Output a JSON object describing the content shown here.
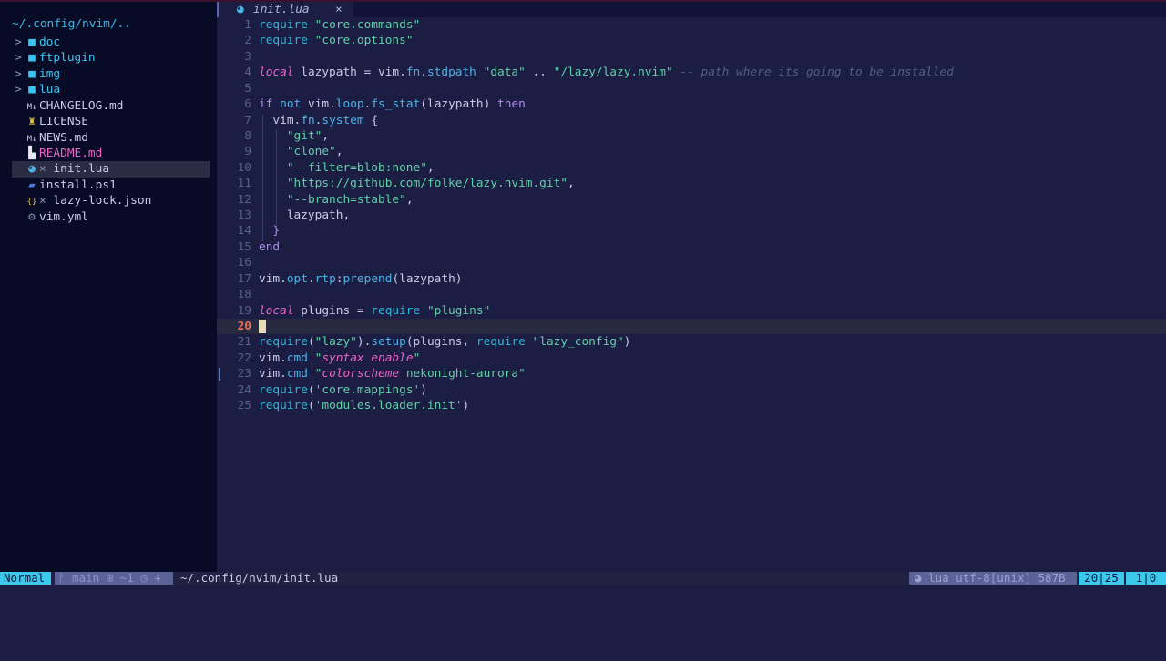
{
  "tabline": {
    "tab": {
      "icon": "lua-icon",
      "name": "init.lua",
      "close": "×"
    }
  },
  "sidebar": {
    "root": "~/.config/nvim/..",
    "items": [
      {
        "name": "doc",
        "type": "folder",
        "chevron": ">",
        "icon": "folder-icon",
        "glyph": "■"
      },
      {
        "name": "ftplugin",
        "type": "folder",
        "chevron": ">",
        "icon": "folder-icon",
        "glyph": "■"
      },
      {
        "name": "img",
        "type": "folder",
        "chevron": ">",
        "icon": "folder-icon",
        "glyph": "■"
      },
      {
        "name": "lua",
        "type": "folder",
        "chevron": ">",
        "icon": "folder-icon",
        "glyph": "■"
      },
      {
        "name": "CHANGELOG.md",
        "type": "file",
        "icon": "markdown-icon",
        "glyph": "M↓",
        "color": "#c8cbe8"
      },
      {
        "name": "LICENSE",
        "type": "file",
        "icon": "license-icon",
        "glyph": "♜",
        "color": "#e0c040"
      },
      {
        "name": "NEWS.md",
        "type": "file",
        "icon": "markdown-icon",
        "glyph": "M↓",
        "color": "#c8cbe8"
      },
      {
        "name": "README.md",
        "type": "file",
        "icon": "readme-icon",
        "glyph": "▙",
        "color": "#e8e8f0",
        "special": "readme"
      },
      {
        "name": "init.lua",
        "type": "file",
        "icon": "lua-icon",
        "glyph": "◕",
        "color": "#4cb3e8",
        "modified": "×",
        "selected": true
      },
      {
        "name": "install.ps1",
        "type": "file",
        "icon": "powershell-icon",
        "glyph": "▰",
        "color": "#4c7ad8"
      },
      {
        "name": "lazy-lock.json",
        "type": "file",
        "icon": "json-icon",
        "glyph": "{}",
        "color": "#e0c040",
        "modified": "×"
      },
      {
        "name": "vim.yml",
        "type": "file",
        "icon": "gear-icon",
        "glyph": "⚙",
        "color": "#8a90a8"
      }
    ]
  },
  "editor": {
    "current_line": 20,
    "lines": [
      [
        [
          "k",
          "require"
        ],
        [
          "i",
          " "
        ],
        [
          "s",
          "\"core.commands\""
        ]
      ],
      [
        [
          "k",
          "require"
        ],
        [
          "i",
          " "
        ],
        [
          "s",
          "\"core.options\""
        ]
      ],
      [],
      [
        [
          "l",
          "local"
        ],
        [
          "i",
          " lazypath = vim."
        ],
        [
          "f",
          "fn"
        ],
        [
          "i",
          "."
        ],
        [
          "f",
          "stdpath"
        ],
        [
          "i",
          " "
        ],
        [
          "s",
          "\"data\""
        ],
        [
          "i",
          " .. "
        ],
        [
          "s",
          "\"/lazy/lazy.nvim\""
        ],
        [
          "i",
          " "
        ],
        [
          "c",
          "-- path where its going to be installed"
        ]
      ],
      [],
      [
        [
          "w",
          "if"
        ],
        [
          "i",
          " "
        ],
        [
          "f",
          "not"
        ],
        [
          "i",
          " vim."
        ],
        [
          "f",
          "loop"
        ],
        [
          "i",
          "."
        ],
        [
          "f",
          "fs_stat"
        ],
        [
          "i",
          "(lazypath) "
        ],
        [
          "w",
          "then"
        ]
      ],
      [
        [
          "i",
          "  vim."
        ],
        [
          "f",
          "fn"
        ],
        [
          "i",
          "."
        ],
        [
          "f",
          "system"
        ],
        [
          "i",
          " {"
        ]
      ],
      [
        [
          "i",
          "    "
        ],
        [
          "s",
          "\"git\""
        ],
        [
          "i",
          ","
        ]
      ],
      [
        [
          "i",
          "    "
        ],
        [
          "s",
          "\"clone\""
        ],
        [
          "i",
          ","
        ]
      ],
      [
        [
          "i",
          "    "
        ],
        [
          "s",
          "\"--filter=blob:none\""
        ],
        [
          "i",
          ","
        ]
      ],
      [
        [
          "i",
          "    "
        ],
        [
          "s",
          "\"https://github.com/folke/lazy.nvim.git\""
        ],
        [
          "i",
          ","
        ]
      ],
      [
        [
          "i",
          "    "
        ],
        [
          "s",
          "\"--branch=stable\""
        ],
        [
          "i",
          ","
        ]
      ],
      [
        [
          "i",
          "    lazypath,"
        ]
      ],
      [
        [
          "i",
          "  "
        ],
        [
          "w",
          "}"
        ]
      ],
      [
        [
          "w",
          "end"
        ]
      ],
      [],
      [
        [
          "i",
          "vim."
        ],
        [
          "f",
          "opt"
        ],
        [
          "i",
          "."
        ],
        [
          "f",
          "rtp"
        ],
        [
          "i",
          ":"
        ],
        [
          "f",
          "prepend"
        ],
        [
          "i",
          "(lazypath)"
        ]
      ],
      [],
      [
        [
          "l",
          "local"
        ],
        [
          "i",
          " plugins = "
        ],
        [
          "k",
          "require"
        ],
        [
          "i",
          " "
        ],
        [
          "s",
          "\"plugins\""
        ]
      ],
      [],
      [
        [
          "k",
          "require"
        ],
        [
          "i",
          "("
        ],
        [
          "s",
          "\"lazy\""
        ],
        [
          "i",
          ")."
        ],
        [
          "f",
          "setup"
        ],
        [
          "i",
          "(plugins, "
        ],
        [
          "k",
          "require"
        ],
        [
          "i",
          " "
        ],
        [
          "s",
          "\"lazy_config\""
        ],
        [
          "i",
          ")"
        ]
      ],
      [
        [
          "i",
          "vim."
        ],
        [
          "f",
          "cmd"
        ],
        [
          "i",
          " "
        ],
        [
          "s",
          "\""
        ],
        [
          "si",
          "syntax enable"
        ],
        [
          "s",
          "\""
        ]
      ],
      [
        [
          "i",
          "vim."
        ],
        [
          "f",
          "cmd"
        ],
        [
          "i",
          " "
        ],
        [
          "s",
          "\""
        ],
        [
          "si",
          "colorscheme"
        ],
        [
          "s",
          " nekonight-aurora\""
        ]
      ],
      [
        [
          "k",
          "require"
        ],
        [
          "i",
          "("
        ],
        [
          "s",
          "'core.mappings'"
        ],
        [
          "i",
          ")"
        ]
      ],
      [
        [
          "k",
          "require"
        ],
        [
          "i",
          "("
        ],
        [
          "s",
          "'modules.loader.init'"
        ],
        [
          "i",
          ")"
        ]
      ]
    ]
  },
  "statusline": {
    "mode": "Normal",
    "git": "ᚠ main ⊞ ~1 ◷ +",
    "path": "~/.config/nvim/init.lua",
    "fileinfo": "◕ lua utf-8[unix] 587B",
    "position": "20|25",
    "column": "1|0"
  }
}
